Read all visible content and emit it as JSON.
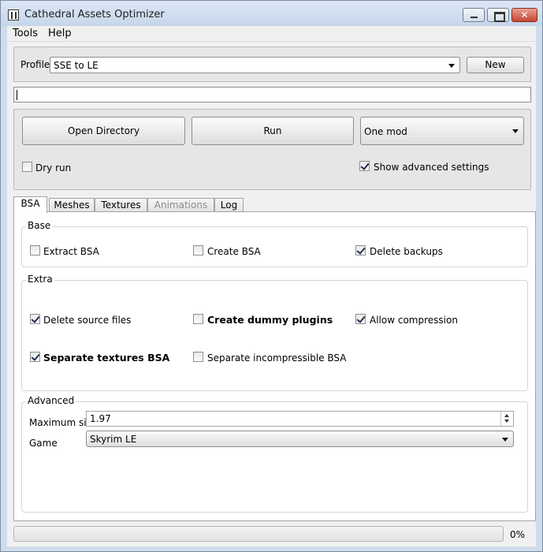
{
  "window": {
    "title": "Cathedral Assets Optimizer"
  },
  "menu": {
    "items": [
      "Tools",
      "Help"
    ]
  },
  "profile": {
    "label": "Profile",
    "selected": "SSE to LE",
    "new_button": "New"
  },
  "path_input": {
    "value": ""
  },
  "actions": {
    "open_directory": "Open Directory",
    "run": "Run",
    "mode_selected": "One mod",
    "dry_run": {
      "label": "Dry run",
      "checked": false
    },
    "show_advanced": {
      "label": "Show advanced settings",
      "checked": true
    }
  },
  "tabs": [
    {
      "label": "BSA",
      "active": true,
      "disabled": false
    },
    {
      "label": "Meshes",
      "active": false,
      "disabled": false
    },
    {
      "label": "Textures",
      "active": false,
      "disabled": false
    },
    {
      "label": "Animations",
      "active": false,
      "disabled": true
    },
    {
      "label": "Log",
      "active": false,
      "disabled": false
    }
  ],
  "bsa": {
    "base": {
      "title": "Base",
      "extract": {
        "label": "Extract BSA",
        "checked": false
      },
      "create": {
        "label": "Create BSA",
        "checked": false
      },
      "delete_backups": {
        "label": "Delete backups",
        "checked": true
      }
    },
    "extra": {
      "title": "Extra",
      "delete_source": {
        "label": "Delete source files",
        "checked": true
      },
      "dummy_plugins": {
        "label": "Create dummy plugins",
        "checked": false
      },
      "allow_compression": {
        "label": "Allow compression",
        "checked": true
      },
      "separate_textures": {
        "label": "Separate textures BSA",
        "checked": true
      },
      "separate_incompressible": {
        "label": "Separate incompressible BSA",
        "checked": false
      }
    },
    "advanced": {
      "title": "Advanced",
      "max_size_label": "Maximum size",
      "max_size_value": "1.97",
      "game_label": "Game",
      "game_selected": "Skyrim LE"
    }
  },
  "progress": {
    "value": 0,
    "text": "0%"
  },
  "colors": {
    "titlebar": "#cfdcec",
    "panel": "#e6e6e6",
    "close_button": "#c74531"
  }
}
